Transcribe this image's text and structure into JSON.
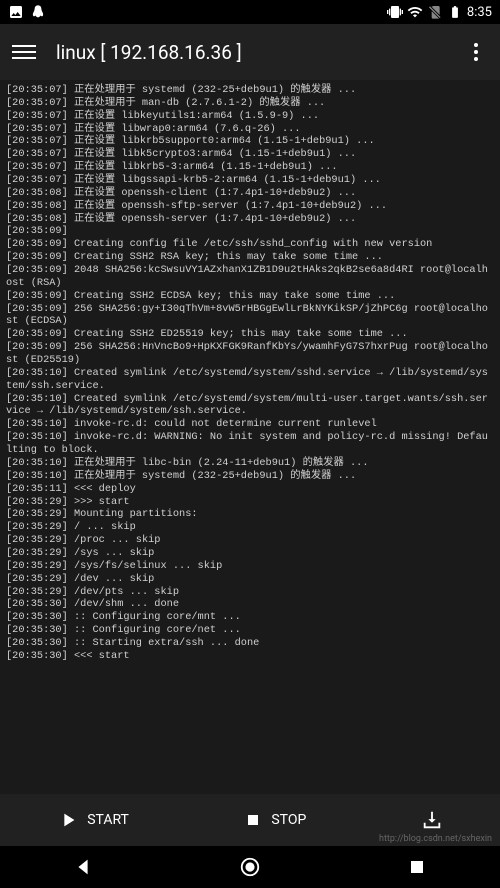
{
  "status_bar": {
    "time": "8:35",
    "icons": [
      "image-icon",
      "penguin-icon",
      "vibrate-icon",
      "wifi-icon",
      "no-sim-icon",
      "battery-icon"
    ]
  },
  "app_bar": {
    "title": "linux  [ 192.168.16.36 ]"
  },
  "terminal": {
    "lines": [
      "[20:35:07] 正在处理用于 systemd (232-25+deb9u1) 的触发器 ...",
      "[20:35:07] 正在处理用于 man-db (2.7.6.1-2) 的触发器 ...",
      "[20:35:07] 正在设置 libkeyutils1:arm64 (1.5.9-9) ...",
      "[20:35:07] 正在设置 libwrap0:arm64 (7.6.q-26) ...",
      "[20:35:07] 正在设置 libkrb5support0:arm64 (1.15-1+deb9u1) ...",
      "[20:35:07] 正在设置 libk5crypto3:arm64 (1.15-1+deb9u1) ...",
      "[20:35:07] 正在设置 libkrb5-3:arm64 (1.15-1+deb9u1) ...",
      "[20:35:07] 正在设置 libgssapi-krb5-2:arm64 (1.15-1+deb9u1) ...",
      "[20:35:08] 正在设置 openssh-client (1:7.4p1-10+deb9u2) ...",
      "[20:35:08] 正在设置 openssh-sftp-server (1:7.4p1-10+deb9u2) ...",
      "[20:35:08] 正在设置 openssh-server (1:7.4p1-10+deb9u2) ...",
      "[20:35:09]",
      "[20:35:09] Creating config file /etc/ssh/sshd_config with new version",
      "[20:35:09] Creating SSH2 RSA key; this may take some time ...",
      "[20:35:09] 2048 SHA256:kcSwsuVY1AZxhanX1ZB1D9u2tHAks2qkB2se6a8d4RI root@localhost (RSA)",
      "[20:35:09] Creating SSH2 ECDSA key; this may take some time ...",
      "[20:35:09] 256 SHA256:gy+I30qThVm+8vW5rHBGgEwlLrBkNYKikSP/jZhPC6g root@localhost (ECDSA)",
      "[20:35:09] Creating SSH2 ED25519 key; this may take some time ...",
      "[20:35:09] 256 SHA256:HnVncBo9+HpKXFGK9RanfKbYs/ywamhFyG7S7hxrPug root@localhost (ED25519)",
      "[20:35:10] Created symlink /etc/systemd/system/sshd.service → /lib/systemd/system/ssh.service.",
      "[20:35:10] Created symlink /etc/systemd/system/multi-user.target.wants/ssh.service → /lib/systemd/system/ssh.service.",
      "[20:35:10] invoke-rc.d: could not determine current runlevel",
      "[20:35:10] invoke-rc.d: WARNING: No init system and policy-rc.d missing! Defaulting to block.",
      "[20:35:10] 正在处理用于 libc-bin (2.24-11+deb9u1) 的触发器 ...",
      "[20:35:10] 正在处理用于 systemd (232-25+deb9u1) 的触发器 ...",
      "[20:35:11] <<< deploy",
      "[20:35:29] >>> start",
      "[20:35:29] Mounting partitions:",
      "[20:35:29] / ... skip",
      "[20:35:29] /proc ... skip",
      "[20:35:29] /sys ... skip",
      "[20:35:29] /sys/fs/selinux ... skip",
      "[20:35:29] /dev ... skip",
      "[20:35:29] /dev/pts ... skip",
      "[20:35:30] /dev/shm ... done",
      "[20:35:30] :: Configuring core/mnt ...",
      "[20:35:30] :: Configuring core/net ...",
      "[20:35:30] :: Starting extra/ssh ... done",
      "[20:35:30] <<< start"
    ]
  },
  "bottom_bar": {
    "start_label": "START",
    "stop_label": "STOP"
  },
  "watermark": "http://blog.csdn.net/sxhexin"
}
